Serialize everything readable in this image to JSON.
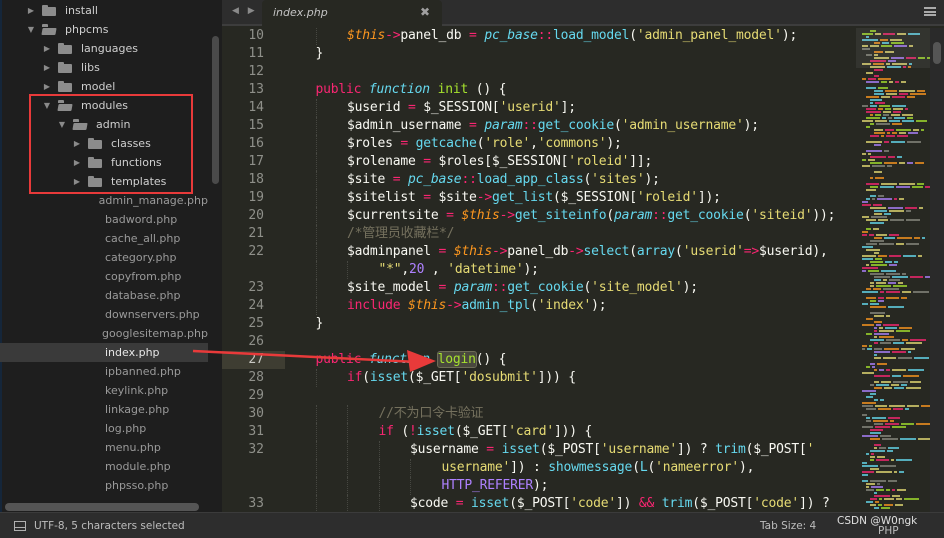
{
  "sidebar": {
    "tree": [
      {
        "label": "install",
        "type": "folder",
        "depth": 1,
        "expanded": false
      },
      {
        "label": "phpcms",
        "type": "folder",
        "depth": 1,
        "expanded": true
      },
      {
        "label": "languages",
        "type": "folder",
        "depth": 2,
        "expanded": false
      },
      {
        "label": "libs",
        "type": "folder",
        "depth": 2,
        "expanded": false
      },
      {
        "label": "model",
        "type": "folder",
        "depth": 2,
        "expanded": false
      },
      {
        "label": "modules",
        "type": "folder",
        "depth": 2,
        "expanded": true
      },
      {
        "label": "admin",
        "type": "folder",
        "depth": 3,
        "expanded": true
      },
      {
        "label": "classes",
        "type": "folder",
        "depth": 4,
        "expanded": false
      },
      {
        "label": "functions",
        "type": "folder",
        "depth": 4,
        "expanded": false
      },
      {
        "label": "templates",
        "type": "folder",
        "depth": 4,
        "expanded": false
      },
      {
        "label": "admin_manage.php",
        "type": "file",
        "depth": 4
      },
      {
        "label": "badword.php",
        "type": "file",
        "depth": 4
      },
      {
        "label": "cache_all.php",
        "type": "file",
        "depth": 4
      },
      {
        "label": "category.php",
        "type": "file",
        "depth": 4
      },
      {
        "label": "copyfrom.php",
        "type": "file",
        "depth": 4
      },
      {
        "label": "database.php",
        "type": "file",
        "depth": 4
      },
      {
        "label": "downservers.php",
        "type": "file",
        "depth": 4
      },
      {
        "label": "googlesitemap.php",
        "type": "file",
        "depth": 4
      },
      {
        "label": "index.php",
        "type": "file",
        "depth": 4,
        "selected": true
      },
      {
        "label": "ipbanned.php",
        "type": "file",
        "depth": 4
      },
      {
        "label": "keylink.php",
        "type": "file",
        "depth": 4
      },
      {
        "label": "linkage.php",
        "type": "file",
        "depth": 4
      },
      {
        "label": "log.php",
        "type": "file",
        "depth": 4
      },
      {
        "label": "menu.php",
        "type": "file",
        "depth": 4
      },
      {
        "label": "module.php",
        "type": "file",
        "depth": 4
      },
      {
        "label": "phpsso.php",
        "type": "file",
        "depth": 4
      }
    ]
  },
  "tabs": {
    "nav_arrows": "◀ ▶",
    "active": {
      "label": "index.php",
      "close": "✖"
    }
  },
  "editor": {
    "active_line": 27,
    "selected_text": "login",
    "lines": [
      {
        "n": "10",
        "indent": 2,
        "tokens": [
          [
            "var",
            "$this"
          ],
          [
            "op",
            "->"
          ],
          [
            "",
            "panel_db "
          ],
          [
            "op",
            "="
          ],
          [
            "",
            " "
          ],
          [
            "cls",
            "pc_base"
          ],
          [
            "op",
            "::"
          ],
          [
            "call",
            "load_model"
          ],
          [
            "",
            "("
          ],
          [
            "str",
            "'admin_panel_model'"
          ],
          [
            "",
            ");"
          ]
        ]
      },
      {
        "n": "11",
        "indent": 1,
        "tokens": [
          [
            "",
            "}"
          ]
        ]
      },
      {
        "n": "12",
        "indent": 0,
        "tokens": []
      },
      {
        "n": "13",
        "indent": 1,
        "tokens": [
          [
            "kw",
            "public"
          ],
          [
            "",
            " "
          ],
          [
            "st",
            "function"
          ],
          [
            "",
            " "
          ],
          [
            "fn",
            "init"
          ],
          [
            "",
            " () {"
          ]
        ]
      },
      {
        "n": "14",
        "indent": 2,
        "tokens": [
          [
            "",
            "$userid "
          ],
          [
            "op",
            "="
          ],
          [
            "",
            " $_SESSION["
          ],
          [
            "str",
            "'userid'"
          ],
          [
            "",
            "];"
          ]
        ]
      },
      {
        "n": "15",
        "indent": 2,
        "tokens": [
          [
            "",
            "$admin_username "
          ],
          [
            "op",
            "="
          ],
          [
            "",
            " "
          ],
          [
            "cls",
            "param"
          ],
          [
            "op",
            "::"
          ],
          [
            "call",
            "get_cookie"
          ],
          [
            "",
            "("
          ],
          [
            "str",
            "'admin_username'"
          ],
          [
            "",
            ");"
          ]
        ]
      },
      {
        "n": "16",
        "indent": 2,
        "tokens": [
          [
            "",
            "$roles "
          ],
          [
            "op",
            "="
          ],
          [
            "",
            " "
          ],
          [
            "call",
            "getcache"
          ],
          [
            "",
            "("
          ],
          [
            "str",
            "'role'"
          ],
          [
            "",
            ","
          ],
          [
            "str",
            "'commons'"
          ],
          [
            "",
            ");"
          ]
        ]
      },
      {
        "n": "17",
        "indent": 2,
        "tokens": [
          [
            "",
            "$rolename "
          ],
          [
            "op",
            "="
          ],
          [
            "",
            " $roles[$_SESSION["
          ],
          [
            "str",
            "'roleid'"
          ],
          [
            "",
            "]];"
          ]
        ]
      },
      {
        "n": "18",
        "indent": 2,
        "tokens": [
          [
            "",
            "$site "
          ],
          [
            "op",
            "="
          ],
          [
            "",
            " "
          ],
          [
            "cls",
            "pc_base"
          ],
          [
            "op",
            "::"
          ],
          [
            "call",
            "load_app_class"
          ],
          [
            "",
            "("
          ],
          [
            "str",
            "'sites'"
          ],
          [
            "",
            ");"
          ]
        ]
      },
      {
        "n": "19",
        "indent": 2,
        "tokens": [
          [
            "",
            "$sitelist "
          ],
          [
            "op",
            "="
          ],
          [
            "",
            " $site"
          ],
          [
            "op",
            "->"
          ],
          [
            "call",
            "get_list"
          ],
          [
            "",
            "($_SESSION["
          ],
          [
            "str",
            "'roleid'"
          ],
          [
            "",
            "]);"
          ]
        ]
      },
      {
        "n": "20",
        "indent": 2,
        "tokens": [
          [
            "",
            "$currentsite "
          ],
          [
            "op",
            "="
          ],
          [
            "",
            " "
          ],
          [
            "var",
            "$this"
          ],
          [
            "op",
            "->"
          ],
          [
            "call",
            "get_siteinfo"
          ],
          [
            "",
            "("
          ],
          [
            "cls",
            "param"
          ],
          [
            "op",
            "::"
          ],
          [
            "call",
            "get_cookie"
          ],
          [
            "",
            "("
          ],
          [
            "str",
            "'siteid'"
          ],
          [
            "",
            "));"
          ]
        ]
      },
      {
        "n": "21",
        "indent": 2,
        "tokens": [
          [
            "cmt",
            "/*管理员收藏栏*/"
          ]
        ]
      },
      {
        "n": "22",
        "indent": 2,
        "tokens": [
          [
            "",
            "$adminpanel "
          ],
          [
            "op",
            "="
          ],
          [
            "",
            " "
          ],
          [
            "var",
            "$this"
          ],
          [
            "op",
            "->"
          ],
          [
            "",
            "panel_db"
          ],
          [
            "op",
            "->"
          ],
          [
            "call",
            "select"
          ],
          [
            "",
            "("
          ],
          [
            "call",
            "array"
          ],
          [
            "",
            "("
          ],
          [
            "str",
            "'userid'"
          ],
          [
            "op",
            "=>"
          ],
          [
            "",
            "$userid),"
          ]
        ]
      },
      {
        "n": "",
        "indent": 3,
        "wrap": true,
        "tokens": [
          [
            "str",
            "\"*\""
          ],
          [
            "",
            ","
          ],
          [
            "num",
            "20"
          ],
          [
            "",
            " , "
          ],
          [
            "str",
            "'datetime'"
          ],
          [
            "",
            ");"
          ]
        ]
      },
      {
        "n": "23",
        "indent": 2,
        "tokens": [
          [
            "",
            "$site_model "
          ],
          [
            "op",
            "="
          ],
          [
            "",
            " "
          ],
          [
            "cls",
            "param"
          ],
          [
            "op",
            "::"
          ],
          [
            "call",
            "get_cookie"
          ],
          [
            "",
            "("
          ],
          [
            "str",
            "'site_model'"
          ],
          [
            "",
            ");"
          ]
        ]
      },
      {
        "n": "24",
        "indent": 2,
        "tokens": [
          [
            "kw",
            "include"
          ],
          [
            "",
            " "
          ],
          [
            "var",
            "$this"
          ],
          [
            "op",
            "->"
          ],
          [
            "call",
            "admin_tpl"
          ],
          [
            "",
            "("
          ],
          [
            "str",
            "'index'"
          ],
          [
            "",
            ");"
          ]
        ]
      },
      {
        "n": "25",
        "indent": 1,
        "tokens": [
          [
            "",
            "}"
          ]
        ]
      },
      {
        "n": "26",
        "indent": 0,
        "tokens": []
      },
      {
        "n": "27",
        "indent": 1,
        "tokens": [
          [
            "kw",
            "public"
          ],
          [
            "",
            " "
          ],
          [
            "st",
            "function"
          ],
          [
            "",
            " "
          ],
          [
            "fn sel-login",
            "login"
          ],
          [
            "",
            "() {"
          ]
        ]
      },
      {
        "n": "28",
        "indent": 2,
        "tokens": [
          [
            "kw",
            "if"
          ],
          [
            "",
            "("
          ],
          [
            "call",
            "isset"
          ],
          [
            "",
            "($_GET["
          ],
          [
            "str",
            "'dosubmit'"
          ],
          [
            "",
            "])) {"
          ]
        ]
      },
      {
        "n": "29",
        "indent": 0,
        "tokens": []
      },
      {
        "n": "30",
        "indent": 3,
        "tokens": [
          [
            "cmt",
            "//不为口令卡验证"
          ]
        ]
      },
      {
        "n": "31",
        "indent": 3,
        "tokens": [
          [
            "kw",
            "if"
          ],
          [
            "",
            " ("
          ],
          [
            "op",
            "!"
          ],
          [
            "call",
            "isset"
          ],
          [
            "",
            "($_GET["
          ],
          [
            "str",
            "'card'"
          ],
          [
            "",
            "])) {"
          ]
        ]
      },
      {
        "n": "32",
        "indent": 4,
        "tokens": [
          [
            "",
            "$username "
          ],
          [
            "op",
            "="
          ],
          [
            "",
            " "
          ],
          [
            "call",
            "isset"
          ],
          [
            "",
            "($_POST["
          ],
          [
            "str",
            "'username'"
          ],
          [
            "",
            "]) ? "
          ],
          [
            "call",
            "trim"
          ],
          [
            "",
            "($_POST["
          ],
          [
            "str",
            "'"
          ]
        ]
      },
      {
        "n": "",
        "indent": 5,
        "wrap": true,
        "tokens": [
          [
            "str",
            "username'"
          ],
          [
            "",
            "]) : "
          ],
          [
            "call",
            "showmessage"
          ],
          [
            "",
            "("
          ],
          [
            "call",
            "L"
          ],
          [
            "",
            "("
          ],
          [
            "str",
            "'nameerror'"
          ],
          [
            "",
            "),"
          ]
        ]
      },
      {
        "n": "",
        "indent": 5,
        "wrap": true,
        "tokens": [
          [
            "const",
            "HTTP_REFERER"
          ],
          [
            "",
            ");"
          ]
        ]
      },
      {
        "n": "33",
        "indent": 4,
        "tokens": [
          [
            "",
            "$code "
          ],
          [
            "op",
            "="
          ],
          [
            "",
            " "
          ],
          [
            "call",
            "isset"
          ],
          [
            "",
            "($_POST["
          ],
          [
            "str",
            "'code'"
          ],
          [
            "",
            "]) "
          ],
          [
            "op",
            "&&"
          ],
          [
            "",
            " "
          ],
          [
            "call",
            "trim"
          ],
          [
            "",
            "($_POST["
          ],
          [
            "str",
            "'code'"
          ],
          [
            "",
            "]) ?"
          ]
        ]
      }
    ]
  },
  "statusbar": {
    "encoding_selection": "UTF-8, 5 characters selected",
    "tab_size": "Tab Size: 4",
    "syntax": "PHP",
    "watermark": "CSDN @W0ngk"
  },
  "colors": {
    "annotation_red": "#e83a3a",
    "background": "#272822",
    "sidebar": "#1e1e1e"
  }
}
